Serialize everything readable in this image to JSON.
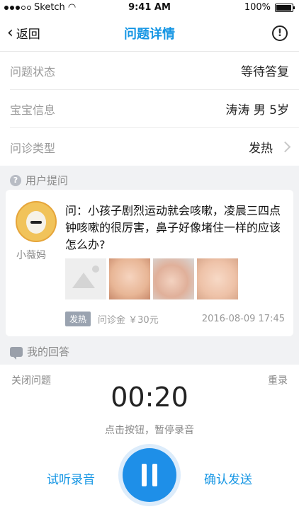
{
  "status": {
    "carrier": "Sketch",
    "time": "9:41 AM",
    "battery": "100%"
  },
  "nav": {
    "back": "返回",
    "title": "问题详情",
    "info_icon": "info-circle-icon"
  },
  "rows": [
    {
      "label": "问题状态",
      "value": "等待答复"
    },
    {
      "label": "宝宝信息",
      "value": "涛涛  男  5岁"
    },
    {
      "label": "问诊类型",
      "value": "发热"
    }
  ],
  "user_section": {
    "title": "用户提问"
  },
  "question": {
    "user": "小薇妈",
    "text": "问：小孩子剧烈运动就会咳嗽，凌晨三四点钟咳嗽的很厉害，鼻子好像堵住一样的应该怎么办?",
    "tag": "发热",
    "fee": "问诊金 ￥30元",
    "time": "2016-08-09  17:45"
  },
  "answer_section": {
    "title": "我的回答"
  },
  "recorder": {
    "close": "关闭问题",
    "redo": "重录",
    "timer": "00:20",
    "hint": "点击按钮，暂停录音",
    "listen": "试听录音",
    "send": "确认发送"
  }
}
